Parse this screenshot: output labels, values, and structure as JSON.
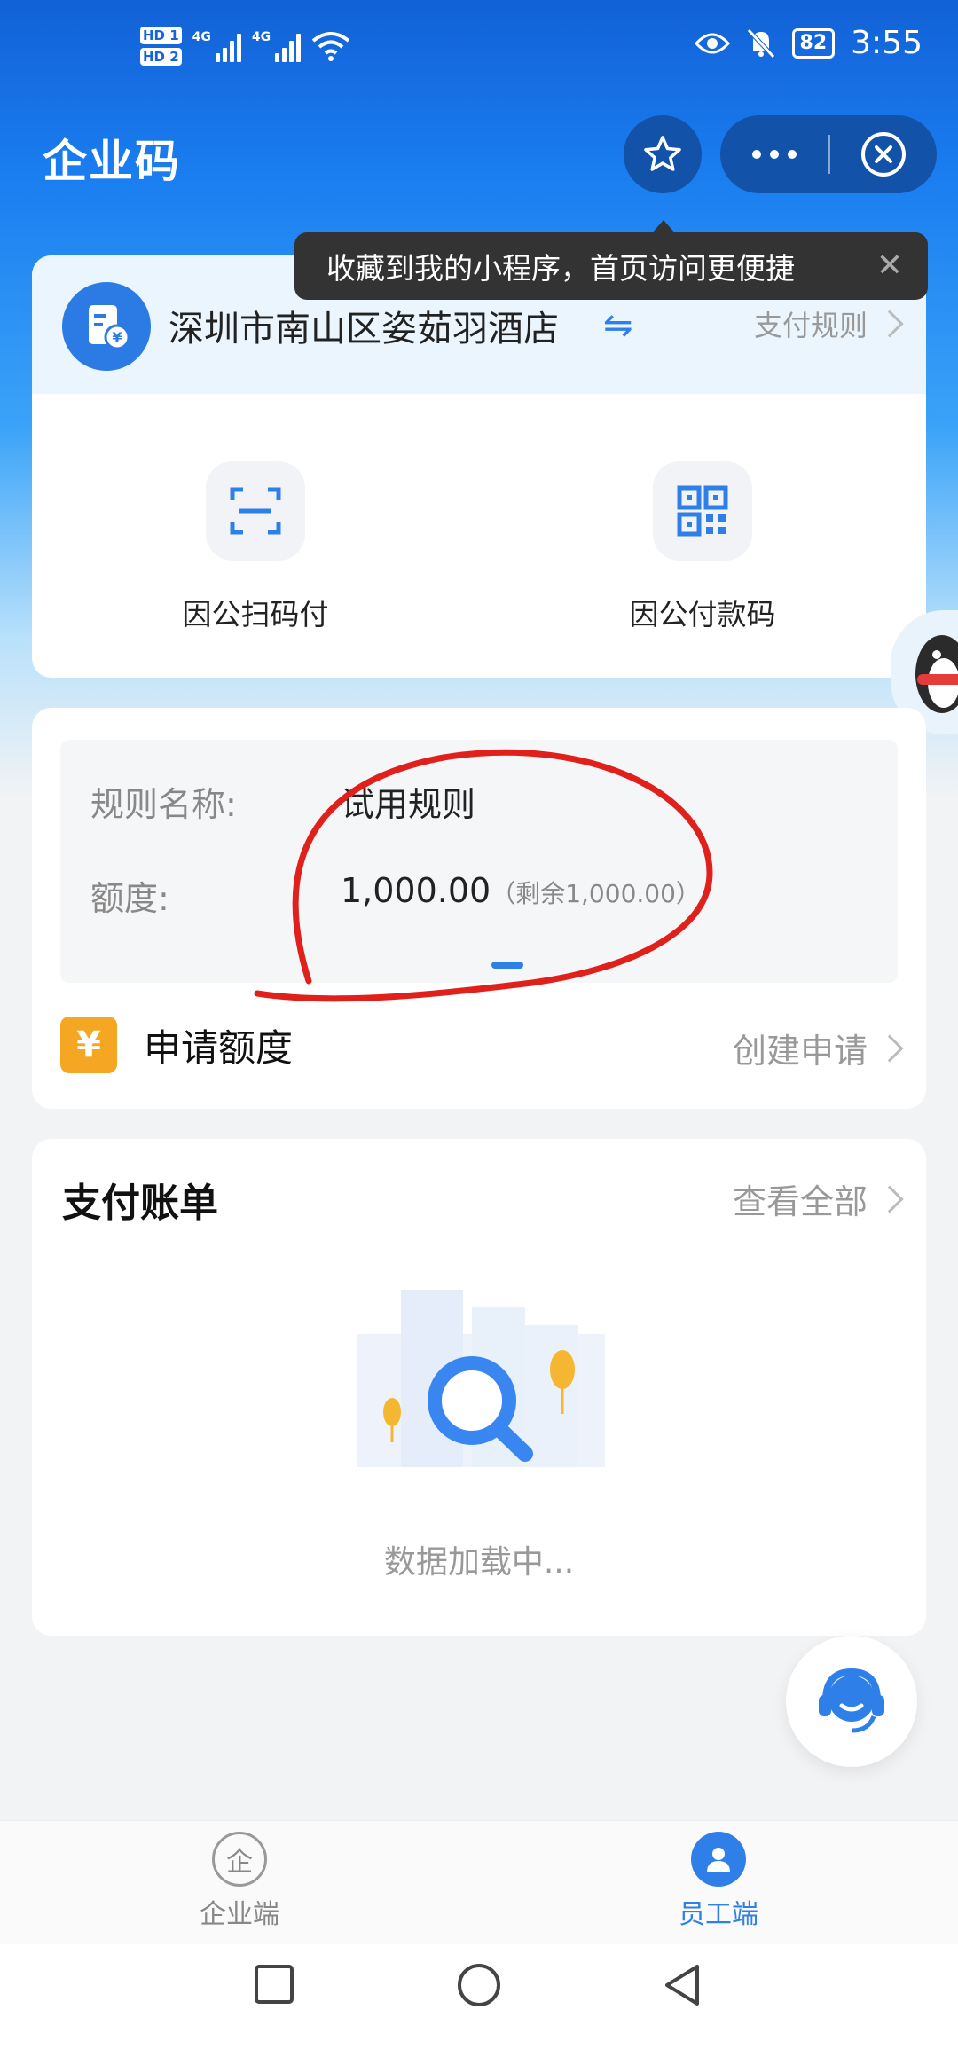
{
  "status_bar": {
    "hd1": "HD 1",
    "hd2": "HD 2",
    "net1": "4G",
    "net2": "4G",
    "battery": "82",
    "time": "3:55"
  },
  "header": {
    "title": "企业码",
    "tooltip": "收藏到我的小程序，首页访问更便捷"
  },
  "company": {
    "name": "深圳市南山区姿茹羽酒店",
    "pay_rules": "支付规则",
    "actions": [
      {
        "label": "因公扫码付",
        "icon": "scan-icon"
      },
      {
        "label": "因公付款码",
        "icon": "qr-code-icon"
      }
    ]
  },
  "rule": {
    "name_key": "规则名称:",
    "name_value": "试用规则",
    "quota_key": "额度:",
    "quota_value": "1,000.00",
    "quota_remaining": "（剩余1,000.00）",
    "apply_label": "申请额度",
    "apply_action": "创建申请"
  },
  "bills": {
    "title": "支付账单",
    "view_all": "查看全部",
    "loading": "数据加载中..."
  },
  "tabs": [
    {
      "label": "企业端",
      "icon_text": "企",
      "active": false
    },
    {
      "label": "员工端",
      "active": true
    }
  ],
  "colors": {
    "accent": "#2f7fe8",
    "header_blue": "#1a7ef0",
    "capsule": "#1252a8",
    "warning": "#f5a623",
    "muted": "#999999"
  }
}
